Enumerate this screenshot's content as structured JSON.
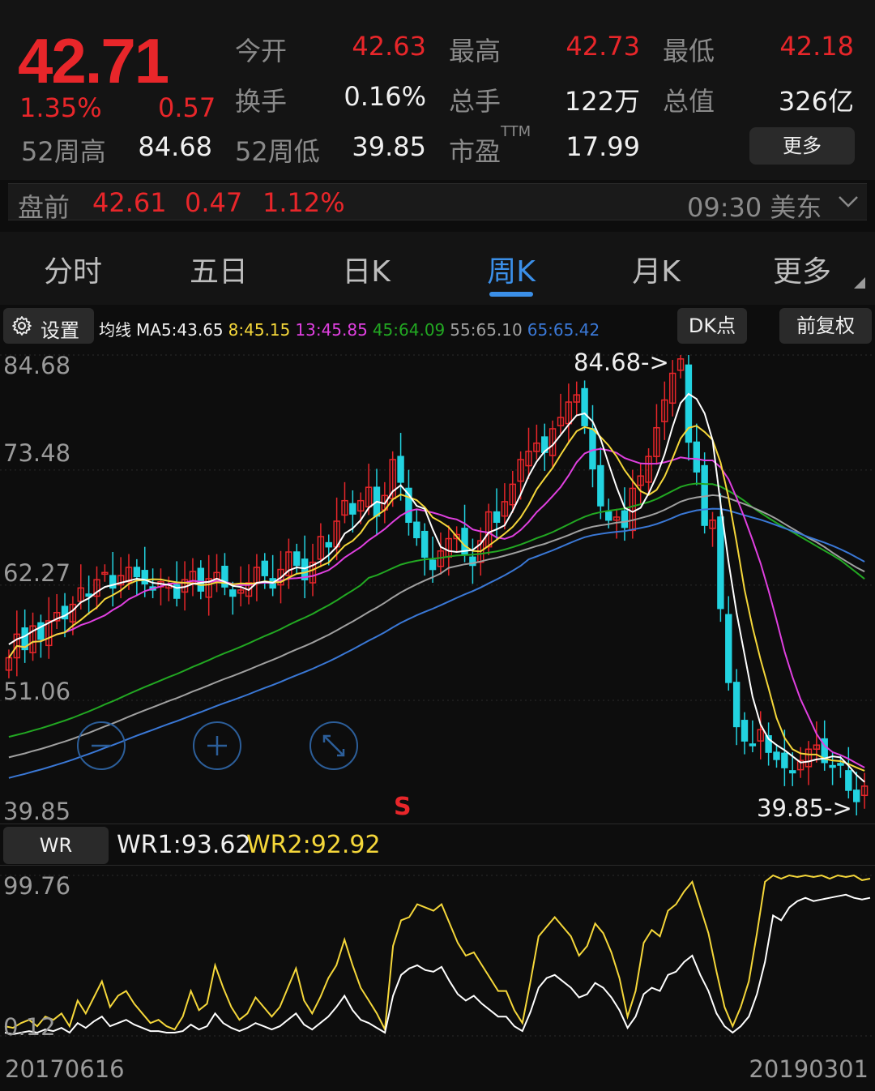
{
  "colors": {
    "up": "#e8262a",
    "down": "#22d3e0",
    "accent": "#3b8fe8",
    "ma5": "#ffffff",
    "ma8": "#f5d73a",
    "ma13": "#e040e0",
    "ma45": "#22a822",
    "ma55": "#a0a0a0",
    "ma65": "#3a78d6"
  },
  "quote": {
    "price": "42.71",
    "change_pct": "1.35%",
    "change_abs": "0.57",
    "open_label": "今开",
    "open": "42.63",
    "high_label": "最高",
    "high": "42.73",
    "low_label": "最低",
    "low": "42.18",
    "turnover_label": "换手",
    "turnover": "0.16%",
    "volume_label": "总手",
    "volume": "122万",
    "mktcap_label": "总值",
    "mktcap": "326亿",
    "w52h_label": "52周高",
    "w52h": "84.68",
    "w52l_label": "52周低",
    "w52l": "39.85",
    "pe_label": "市盈",
    "pe_sup": "TTM",
    "pe": "17.99",
    "more": "更多"
  },
  "premarket": {
    "label": "盘前",
    "price": "42.61",
    "change": "0.47",
    "pct": "1.12%",
    "time": "09:30",
    "tz": "美东",
    "chevron_icon": "chevron-down-icon"
  },
  "tabs": [
    {
      "label": "分时"
    },
    {
      "label": "五日"
    },
    {
      "label": "日K"
    },
    {
      "label": "周K"
    },
    {
      "label": "月K"
    },
    {
      "label": "更多"
    }
  ],
  "active_tab": "周K",
  "toolbar": {
    "settings": "设置",
    "settings_icon": "gear-icon",
    "ma_prefix": "均线",
    "ma5": "MA5:43.65",
    "ma8": "8:45.15",
    "ma13": "13:45.85",
    "ma45": "45:64.09",
    "ma55": "55:65.10",
    "ma65": "65:65.42",
    "dk": "DK点",
    "adjust": "前复权"
  },
  "main_chart": {
    "axis": [
      "84.68",
      "73.48",
      "62.27",
      "51.06",
      "39.85"
    ],
    "high_note": "84.68->",
    "low_note": "39.85->",
    "signal": "S",
    "zoom_icons": [
      "zoom-out-icon",
      "zoom-in-icon",
      "fullscreen-icon"
    ]
  },
  "wr": {
    "button": "WR",
    "wr1": "WR1:93.62",
    "wr2": "WR2:92.92",
    "axis_top": "99.76",
    "axis_bottom": "0.12"
  },
  "dates": {
    "start": "20170616",
    "end": "20190301"
  },
  "chart_data": {
    "type": "candlestick",
    "period": "weekly",
    "y_range": [
      39.85,
      84.68
    ],
    "x_range": [
      "20170616",
      "20190301"
    ],
    "close": [
      55.2,
      57.5,
      56.0,
      58.3,
      57.0,
      58.8,
      59.6,
      59.0,
      60.4,
      62.0,
      61.2,
      62.8,
      63.5,
      62.0,
      63.2,
      64.0,
      63.1,
      62.4,
      61.8,
      62.6,
      62.3,
      61.0,
      62.8,
      63.6,
      61.7,
      62.9,
      63.5,
      62.1,
      61.2,
      61.8,
      62.5,
      64.0,
      63.2,
      62.0,
      63.8,
      65.5,
      64.2,
      62.8,
      64.5,
      67.0,
      66.0,
      68.5,
      70.5,
      69.2,
      70.5,
      71.8,
      69.0,
      71.0,
      74.5,
      72.3,
      68.4,
      66.9,
      65.0,
      63.8,
      65.6,
      66.8,
      67.2,
      65.3,
      64.2,
      66.6,
      69.4,
      68.4,
      70.4,
      72.1,
      74.5,
      75.3,
      76.1,
      75.2,
      77.5,
      78.6,
      80.1,
      80.8,
      77.8,
      73.6,
      70.0,
      68.6,
      68.9,
      67.9,
      71.7,
      72.9,
      74.8,
      77.6,
      80.3,
      82.9,
      84.3,
      76.2,
      73.3,
      68.1,
      68.6,
      60.0,
      52.8,
      48.5,
      47.1,
      46.8,
      48.2,
      46.0,
      45.3,
      44.5,
      44.0,
      45.2,
      46.3,
      46.7,
      45.0,
      44.6,
      44.8,
      42.3,
      41.2,
      42.7
    ],
    "ma5": [
      56.5,
      57.0,
      57.3,
      57.8,
      58.2,
      58.6,
      59.0,
      59.3,
      59.8,
      60.6,
      61.0,
      61.6,
      62.1,
      62.3,
      62.5,
      62.7,
      62.9,
      62.8,
      62.5,
      62.4,
      62.3,
      62.0,
      62.1,
      62.4,
      62.5,
      62.6,
      62.9,
      62.6,
      62.2,
      62.1,
      61.8,
      62.5,
      62.6,
      62.5,
      63.0,
      63.7,
      64.0,
      63.9,
      64.2,
      64.6,
      65.2,
      66.0,
      67.3,
      67.8,
      68.6,
      69.8,
      70.4,
      70.2,
      71.4,
      72.0,
      71.1,
      70.0,
      69.7,
      67.7,
      66.0,
      65.6,
      65.5,
      65.6,
      65.7,
      66.3,
      67.4,
      67.7,
      68.1,
      69.5,
      71.1,
      72.9,
      74.3,
      75.3,
      75.9,
      76.9,
      77.9,
      78.8,
      79.0,
      78.2,
      76.5,
      74.1,
      71.8,
      69.8,
      69.4,
      69.8,
      71.2,
      72.9,
      75.0,
      77.7,
      80.0,
      80.9,
      80.4,
      79.0,
      76.4,
      70.2,
      64.5,
      59.6,
      55.5,
      51.4,
      48.7,
      47.3,
      46.7,
      46.2,
      45.6,
      45.0,
      45.1,
      45.3,
      45.4,
      45.6,
      45.5,
      44.7,
      43.8,
      43.1
    ],
    "wr1": [
      2,
      1,
      2,
      3,
      2,
      4,
      3,
      5,
      2,
      8,
      5,
      9,
      12,
      6,
      8,
      10,
      7,
      5,
      3,
      3,
      2,
      2,
      3,
      7,
      4,
      6,
      14,
      8,
      5,
      3,
      5,
      8,
      6,
      4,
      6,
      10,
      14,
      7,
      4,
      8,
      12,
      18,
      25,
      16,
      10,
      8,
      5,
      2,
      25,
      38,
      42,
      44,
      41,
      40,
      43,
      34,
      26,
      22,
      25,
      20,
      16,
      12,
      12,
      6,
      3,
      15,
      30,
      36,
      38,
      34,
      30,
      24,
      26,
      33,
      30,
      24,
      16,
      5,
      12,
      26,
      30,
      28,
      38,
      40,
      46,
      50,
      38,
      28,
      14,
      6,
      2,
      6,
      12,
      26,
      46,
      75,
      72,
      80,
      84,
      86,
      84,
      85,
      86,
      87,
      88,
      86,
      85,
      86
    ],
    "wr2": [
      6,
      5,
      8,
      10,
      6,
      12,
      10,
      14,
      6,
      22,
      14,
      24,
      34,
      18,
      25,
      28,
      20,
      14,
      8,
      10,
      6,
      4,
      12,
      28,
      16,
      20,
      44,
      30,
      18,
      10,
      14,
      24,
      18,
      12,
      18,
      30,
      42,
      22,
      14,
      24,
      36,
      44,
      60,
      44,
      30,
      22,
      14,
      4,
      56,
      72,
      74,
      82,
      80,
      78,
      82,
      70,
      58,
      50,
      52,
      44,
      36,
      28,
      28,
      16,
      8,
      34,
      62,
      68,
      74,
      68,
      62,
      50,
      56,
      70,
      64,
      52,
      36,
      12,
      28,
      58,
      66,
      62,
      78,
      82,
      90,
      96,
      80,
      64,
      40,
      18,
      6,
      18,
      34,
      64,
      96,
      100,
      98,
      100,
      99,
      100,
      99,
      100,
      98,
      100,
      99,
      100,
      97,
      98
    ]
  }
}
